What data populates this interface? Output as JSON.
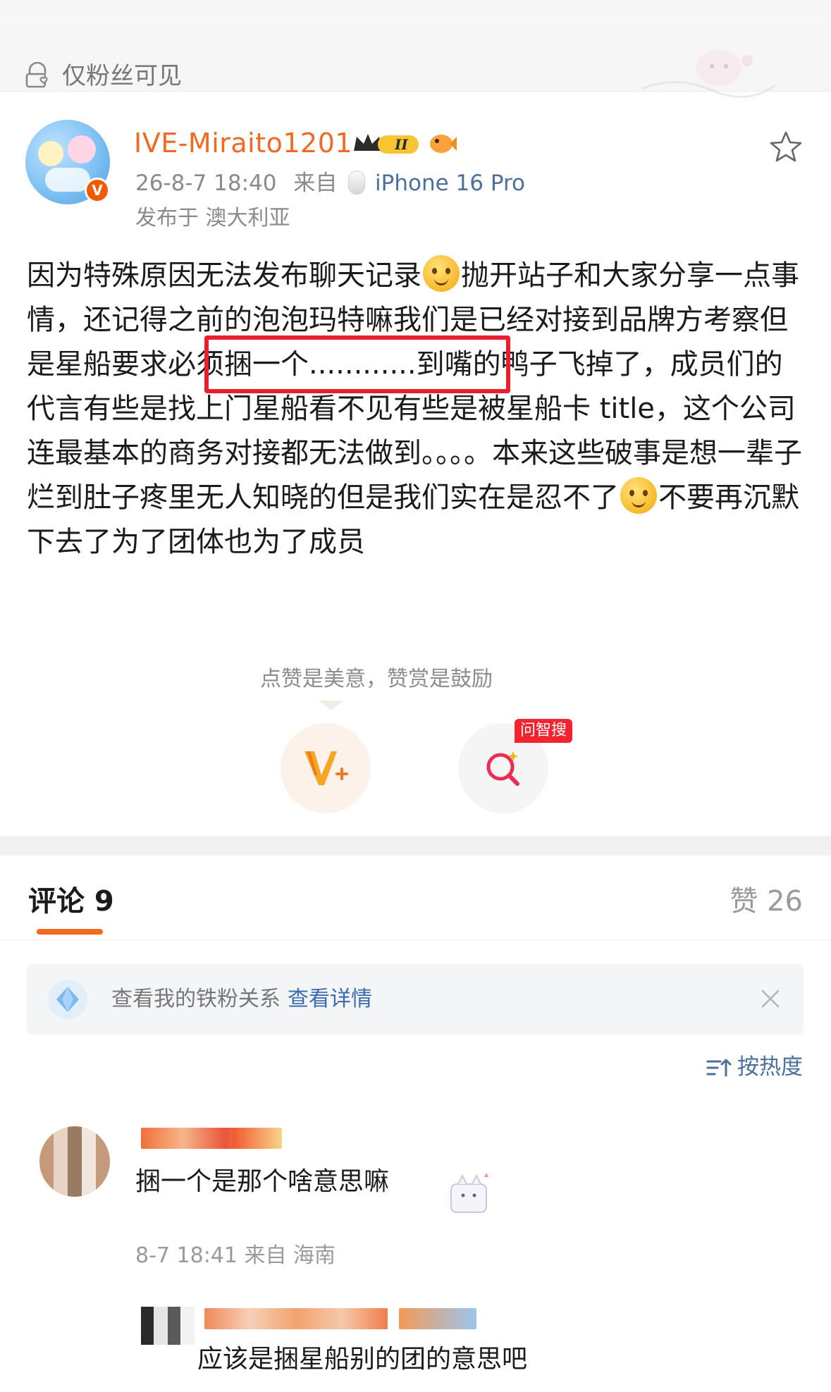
{
  "visibility": {
    "label": "仅粉丝可见"
  },
  "post": {
    "username": "IVE-Miraito1201",
    "rank_badge": "II",
    "timestamp": "26-8-7 18:40",
    "from_label": "来自",
    "device": "iPhone 16 Pro",
    "location": "发布于 澳大利亚",
    "body": {
      "p1": "因为特殊原因无法发布聊天记录",
      "p2": "抛开站子和大家分享一点事情，还记得之前的泡泡玛特嘛我们是已经对接到品牌方考察但是",
      "highlight": "星船要求必须捆一个.",
      "p3": "...........到嘴的鸭子飞掉了，成员们的代言有些是找上门星船看不见有些是被星船卡 title，这个公司连最基本的商务对接都无法做到。。。。本来这些破事是想一辈子烂到肚子疼里无人知晓的但是我们实在是忍不了",
      "p4": "不要再沉默下去了为了团体也为了成员"
    },
    "like_hint": "点赞是美意，赞赏是鼓励",
    "search_badge": "问智搜"
  },
  "comments_section": {
    "title": "评论 9",
    "likes": "赞 26",
    "fan_banner": {
      "text": "查看我的铁粉关系",
      "link": "查看详情"
    },
    "sort_label": "按热度",
    "comments": [
      {
        "text": "捆一个是那个啥意思嘛",
        "meta": "8-7 18:41 来自 海南"
      }
    ],
    "reply": {
      "text": "应该是捆星船别的团的意思吧"
    }
  },
  "colors": {
    "username": "#f06a24",
    "link": "#4a6fa0",
    "highlight_box": "#e8202d",
    "tab_underline": "#f26b1d",
    "badge": "#f2242f"
  },
  "icons": [
    "lock-heart-icon",
    "crown-badge-icon",
    "fish-badge-icon",
    "star-icon",
    "reward-v-icon",
    "smart-search-icon",
    "diamond-icon",
    "close-icon",
    "sort-icon"
  ]
}
